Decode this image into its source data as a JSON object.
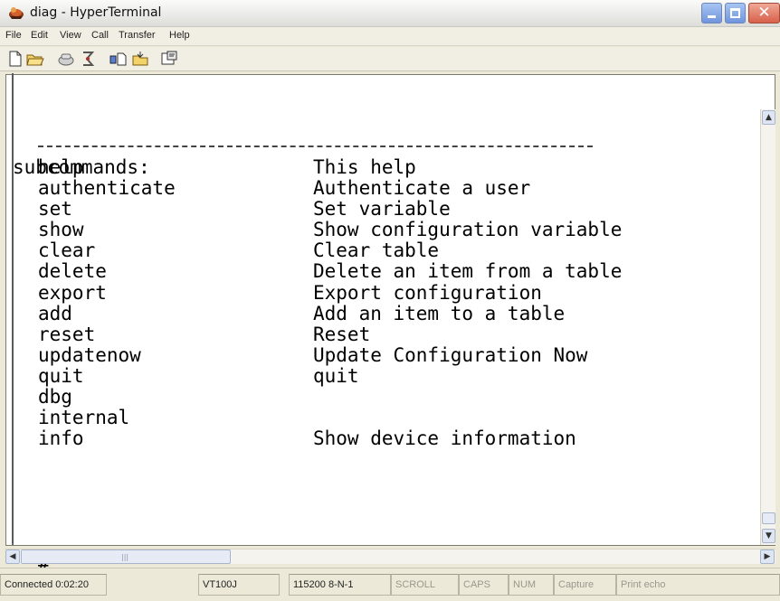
{
  "window": {
    "title": "diag - HyperTerminal"
  },
  "menu": {
    "items": [
      "File",
      "Edit",
      "View",
      "Call",
      "Transfer",
      "Help"
    ]
  },
  "toolbar": {
    "icons": [
      "new-icon",
      "open-icon",
      "dial-icon",
      "disconnect-icon",
      "send-icon",
      "receive-icon",
      "properties-icon"
    ]
  },
  "terminal": {
    "header": "subcommands:",
    "rule": "------------------------------------------",
    "commands": [
      {
        "cmd": "help",
        "desc": "This help"
      },
      {
        "cmd": "authenticate",
        "desc": "Authenticate a user"
      },
      {
        "cmd": "set",
        "desc": "Set variable"
      },
      {
        "cmd": "show",
        "desc": "Show configuration variable"
      },
      {
        "cmd": "clear",
        "desc": "Clear table"
      },
      {
        "cmd": "delete",
        "desc": "Delete an item from a table"
      },
      {
        "cmd": "export",
        "desc": "Export configuration"
      },
      {
        "cmd": "add",
        "desc": "Add an item to a table"
      },
      {
        "cmd": "reset",
        "desc": "Reset"
      },
      {
        "cmd": "updatenow",
        "desc": "Update Configuration Now"
      },
      {
        "cmd": "quit",
        "desc": "quit"
      },
      {
        "cmd": "dbg",
        "desc": ""
      },
      {
        "cmd": "internal",
        "desc": ""
      },
      {
        "cmd": "info",
        "desc": "Show device information"
      }
    ],
    "prompt": "# _"
  },
  "statusbar": {
    "connected": "Connected 0:02:20",
    "emulation": "VT100J",
    "settings": "115200 8-N-1",
    "scroll": "SCROLL",
    "caps": "CAPS",
    "num": "NUM",
    "capture": "Capture",
    "print_echo": "Print echo"
  }
}
